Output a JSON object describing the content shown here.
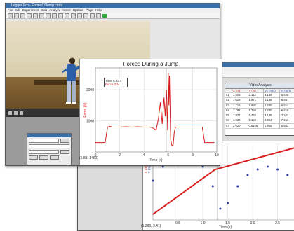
{
  "apps": {
    "front": {
      "title": "Logger Pro - FormsOfJump.cmbl",
      "menu": [
        "File",
        "Edit",
        "Experiment",
        "Data",
        "Analyze",
        "Insert",
        "Options",
        "Page",
        "Help"
      ]
    },
    "back": {
      "title": ""
    }
  },
  "forces_chart": {
    "status": "(5.83, 1460)",
    "readout": {
      "time": "Time 5.83 s",
      "force": "Force 3 N"
    }
  },
  "position_chart": {
    "status": "(1.296, 3.41)"
  },
  "video_analysis": {
    "title": "VideoAnalysis",
    "headers": [
      "X (m)",
      "Y (m)",
      "Vx (m/s)",
      "Vy (m/s)"
    ],
    "row_labels": [
      "61",
      "62",
      "63",
      "64",
      "65",
      "66",
      "67"
    ],
    "rows": [
      [
        "1.508",
        "2.113",
        "3.138",
        "-5.400"
      ],
      [
        "1.628",
        "1.971",
        "3.138",
        "-6.867"
      ],
      [
        "1.716",
        "1.887",
        "3.230",
        "-6.614"
      ],
      [
        "1.791",
        "1.768",
        "3.230",
        "-6.416"
      ],
      [
        "1.877",
        "1.432",
        "3.136",
        "-7.262"
      ],
      [
        "1.932",
        "1.168",
        "2.894",
        "-7.612"
      ],
      [
        "2.020",
        "0.6106",
        "2.826",
        "-5.842"
      ]
    ]
  },
  "chart_data": [
    {
      "type": "line",
      "title": "Forces During a Jump",
      "xlabel": "Time (s)",
      "ylabel": "Force (N)",
      "xlim": [
        0,
        10
      ],
      "ylim": [
        0,
        2700
      ],
      "xticks": [
        0,
        2,
        4,
        6,
        8,
        10
      ],
      "yticks": [
        1000,
        2000
      ],
      "grid": true,
      "color": "#d81f1f",
      "series": [
        {
          "x": [
            0,
            0.3,
            0.6,
            0.8,
            1.0,
            1.2,
            1.4,
            1.6,
            1.8,
            2,
            2.5,
            3,
            3.5,
            4,
            4.5,
            4.8,
            5.0,
            5.2,
            5.35,
            5.5,
            5.65,
            5.75,
            5.85,
            5.95,
            6.0,
            6.05,
            6.1,
            6.2,
            6.3,
            6.4,
            6.5,
            6.6,
            6.8,
            7,
            7.5,
            8,
            8.5,
            8.8,
            9.0,
            9.2,
            9.5,
            9.8
          ],
          "y": [
            300,
            300,
            300,
            300,
            800,
            820,
            800,
            800,
            800,
            800,
            810,
            800,
            810,
            800,
            800,
            760,
            700,
            1100,
            1600,
            900,
            1750,
            1150,
            2000,
            700,
            2550,
            1500,
            2450,
            400,
            200,
            220,
            650,
            800,
            800,
            800,
            800,
            800,
            800,
            800,
            300,
            300,
            300,
            300
          ]
        }
      ]
    },
    {
      "type": "line",
      "xlabel": "Time (s)",
      "ylabel": "X (m)",
      "ylabel_right": "Y (m)",
      "xlim": [
        0,
        2.9
      ],
      "xticks": [
        0.5,
        1.0,
        1.5,
        2.0,
        2.5
      ],
      "grid": true,
      "series": [
        {
          "color": "#d81f1f",
          "x": [
            0,
            1.25,
            2.9
          ],
          "y": [
            0.2,
            1.8,
            2.6
          ]
        },
        {
          "color": "#2a3f9f",
          "x": [
            0,
            0.2,
            0.4,
            0.6,
            0.8,
            1.0,
            1.2,
            1.35,
            1.5,
            1.7,
            1.9,
            2.1,
            2.3,
            2.5,
            2.7,
            2.9
          ],
          "y": [
            1.4,
            1.9,
            2.2,
            2.3,
            2.2,
            1.9,
            1.2,
            0.4,
            0.6,
            1.2,
            1.6,
            1.8,
            1.9,
            1.8,
            1.6,
            1.2
          ]
        }
      ]
    }
  ]
}
